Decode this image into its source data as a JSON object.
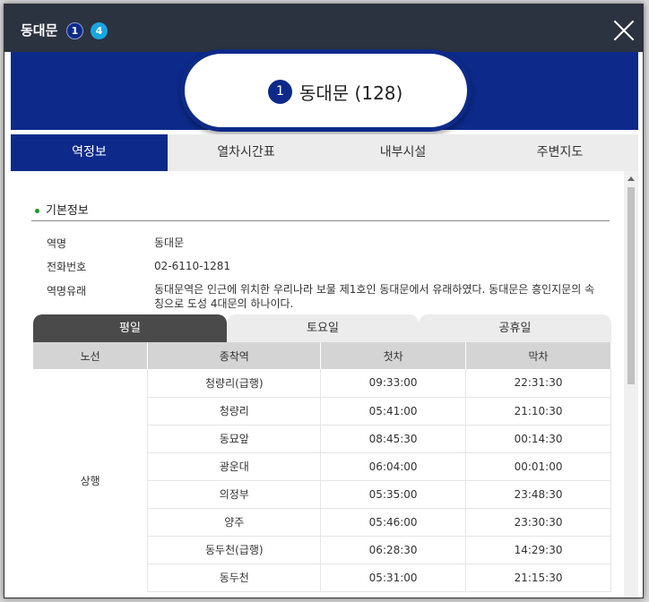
{
  "window": {
    "title": "동대문",
    "line_badges": [
      "1",
      "4"
    ],
    "close_icon": "close-icon"
  },
  "station": {
    "line_number": "1",
    "name_with_code": "동대문 (128)"
  },
  "tabs": [
    "역정보",
    "열차시간표",
    "내부시설",
    "주변지도"
  ],
  "basic_info": {
    "section_title": "기본정보",
    "rows": [
      {
        "label": "역명",
        "value": "동대문"
      },
      {
        "label": "전화번호",
        "value": "02-6110-1281"
      },
      {
        "label": "역명유래",
        "value": "동대문역은 인근에 위치한 우리나라 보물 제1호인 동대문에서 유래하였다. 동대문은 흥인지문의 속칭으로 도성 4대문의 하나이다."
      }
    ]
  },
  "day_tabs": [
    "평일",
    "토요일",
    "공휴일"
  ],
  "timetable": {
    "headers": [
      "노선",
      "종착역",
      "첫차",
      "막차"
    ],
    "direction": "상행",
    "rows": [
      {
        "dest": "청량리(급행)",
        "first": "09:33:00",
        "last": "22:31:30"
      },
      {
        "dest": "청량리",
        "first": "05:41:00",
        "last": "21:10:30"
      },
      {
        "dest": "동묘앞",
        "first": "08:45:30",
        "last": "00:14:30"
      },
      {
        "dest": "광운대",
        "first": "06:04:00",
        "last": "00:01:00"
      },
      {
        "dest": "의정부",
        "first": "05:35:00",
        "last": "23:48:30"
      },
      {
        "dest": "양주",
        "first": "05:46:00",
        "last": "23:30:30"
      },
      {
        "dest": "동두천(급행)",
        "first": "06:28:30",
        "last": "14:29:30"
      },
      {
        "dest": "동두천",
        "first": "05:31:00",
        "last": "21:15:30"
      }
    ]
  },
  "colors": {
    "line1": "#0d2a8a",
    "line4": "#1aa6e0",
    "titlebar": "#2b3240"
  }
}
